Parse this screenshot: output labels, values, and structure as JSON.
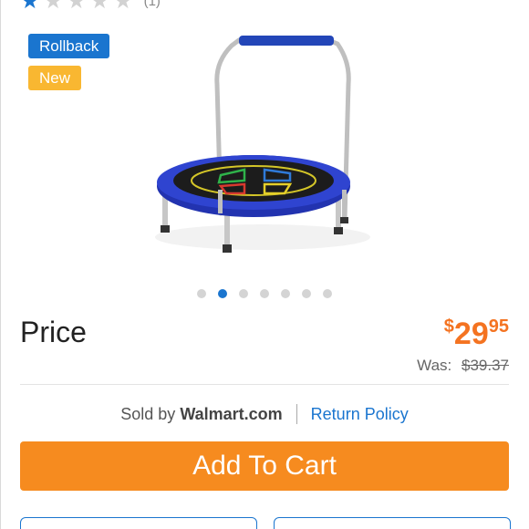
{
  "rating": {
    "filled_star": "★",
    "empty_star": "★",
    "stars_filled": 1,
    "stars_total": 5,
    "review_count": "(1)"
  },
  "badges": {
    "rollback": "Rollback",
    "new": "New"
  },
  "carousel": {
    "total": 7,
    "active_index": 1
  },
  "price": {
    "label": "Price",
    "currency": "$",
    "dollars": "29",
    "cents": "95",
    "was_label": "Was:",
    "was_value": "$39.37"
  },
  "seller": {
    "sold_by_label": "Sold by",
    "name": "Walmart.com",
    "return_policy": "Return Policy"
  },
  "actions": {
    "add_to_cart": "Add To Cart"
  },
  "colors": {
    "brand_blue": "#1a75cf",
    "orange": "#f68b1f",
    "price_orange": "#f47321",
    "badge_yellow": "#f9b731"
  }
}
